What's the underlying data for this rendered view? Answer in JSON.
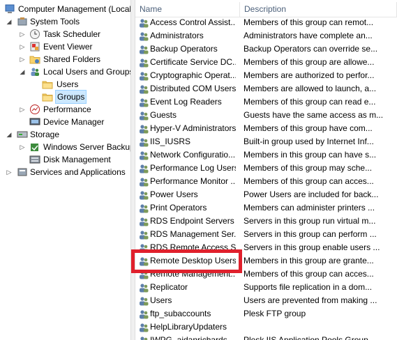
{
  "tree": [
    {
      "label": "Computer Management (Local",
      "icon": "computer-management-icon",
      "name": "tree-item-computer-management",
      "expander": ""
    },
    {
      "label": "System Tools",
      "icon": "system-tools-icon",
      "name": "tree-item-system-tools",
      "expander": "◢"
    },
    {
      "label": "Task Scheduler",
      "icon": "task-scheduler-icon",
      "name": "tree-item-task-scheduler",
      "expander": "▷"
    },
    {
      "label": "Event Viewer",
      "icon": "event-viewer-icon",
      "name": "tree-item-event-viewer",
      "expander": "▷"
    },
    {
      "label": "Shared Folders",
      "icon": "shared-folders-icon",
      "name": "tree-item-shared-folders",
      "expander": "▷"
    },
    {
      "label": "Local Users and Groups",
      "icon": "local-users-groups-icon",
      "name": "tree-item-local-users-groups",
      "expander": "◢"
    },
    {
      "label": "Users",
      "icon": "folder-icon",
      "name": "tree-item-users",
      "expander": ""
    },
    {
      "label": "Groups",
      "icon": "folder-icon",
      "name": "tree-item-groups",
      "expander": ""
    },
    {
      "label": "Performance",
      "icon": "performance-icon",
      "name": "tree-item-performance",
      "expander": "▷"
    },
    {
      "label": "Device Manager",
      "icon": "device-manager-icon",
      "name": "tree-item-device-manager",
      "expander": ""
    },
    {
      "label": "Storage",
      "icon": "storage-icon",
      "name": "tree-item-storage",
      "expander": "◢"
    },
    {
      "label": "Windows Server Backup",
      "icon": "windows-server-backup-icon",
      "name": "tree-item-windows-server-backup",
      "expander": "▷"
    },
    {
      "label": "Disk Management",
      "icon": "disk-management-icon",
      "name": "tree-item-disk-management",
      "expander": ""
    },
    {
      "label": "Services and Applications",
      "icon": "services-applications-icon",
      "name": "tree-item-services-applications",
      "expander": "▷"
    }
  ],
  "columns": {
    "name": "Name",
    "description": "Description"
  },
  "groups": [
    {
      "name": "Access Control Assist...",
      "description": "Members of this group can remot..."
    },
    {
      "name": "Administrators",
      "description": "Administrators have complete an..."
    },
    {
      "name": "Backup Operators",
      "description": "Backup Operators can override se..."
    },
    {
      "name": "Certificate Service DC...",
      "description": "Members of this group are allowe..."
    },
    {
      "name": "Cryptographic Operat...",
      "description": "Members are authorized to perfor..."
    },
    {
      "name": "Distributed COM Users",
      "description": "Members are allowed to launch, a..."
    },
    {
      "name": "Event Log Readers",
      "description": "Members of this group can read e..."
    },
    {
      "name": "Guests",
      "description": "Guests have the same access as m..."
    },
    {
      "name": "Hyper-V Administrators",
      "description": "Members of this group have com..."
    },
    {
      "name": "IIS_IUSRS",
      "description": "Built-in group used by Internet Inf..."
    },
    {
      "name": "Network Configuratio...",
      "description": "Members in this group can have s..."
    },
    {
      "name": "Performance Log Users",
      "description": "Members of this group may sche..."
    },
    {
      "name": "Performance Monitor ...",
      "description": "Members of this group can acces..."
    },
    {
      "name": "Power Users",
      "description": "Power Users are included for back..."
    },
    {
      "name": "Print Operators",
      "description": "Members can administer printers ..."
    },
    {
      "name": "RDS Endpoint Servers",
      "description": "Servers in this group run virtual m..."
    },
    {
      "name": "RDS Management Ser...",
      "description": "Servers in this group can perform ..."
    },
    {
      "name": "RDS Remote Access S...",
      "description": "Servers in this group enable users ..."
    },
    {
      "name": "Remote Desktop Users",
      "description": "Members in this group are grante..."
    },
    {
      "name": "Remote Management...",
      "description": "Members of this group can acces..."
    },
    {
      "name": "Replicator",
      "description": "Supports file replication in a dom..."
    },
    {
      "name": "Users",
      "description": "Users are prevented from making ..."
    },
    {
      "name": "ftp_subaccounts",
      "description": "Plesk FTP group"
    },
    {
      "name": "HelpLibraryUpdaters",
      "description": ""
    },
    {
      "name": "IWPG_aidanrichards",
      "description": "Plesk IIS Application Pools Group"
    }
  ],
  "colors": {
    "highlight_box": "#e0202c",
    "selection": "#cce8ff",
    "header_text": "#4c607a"
  }
}
